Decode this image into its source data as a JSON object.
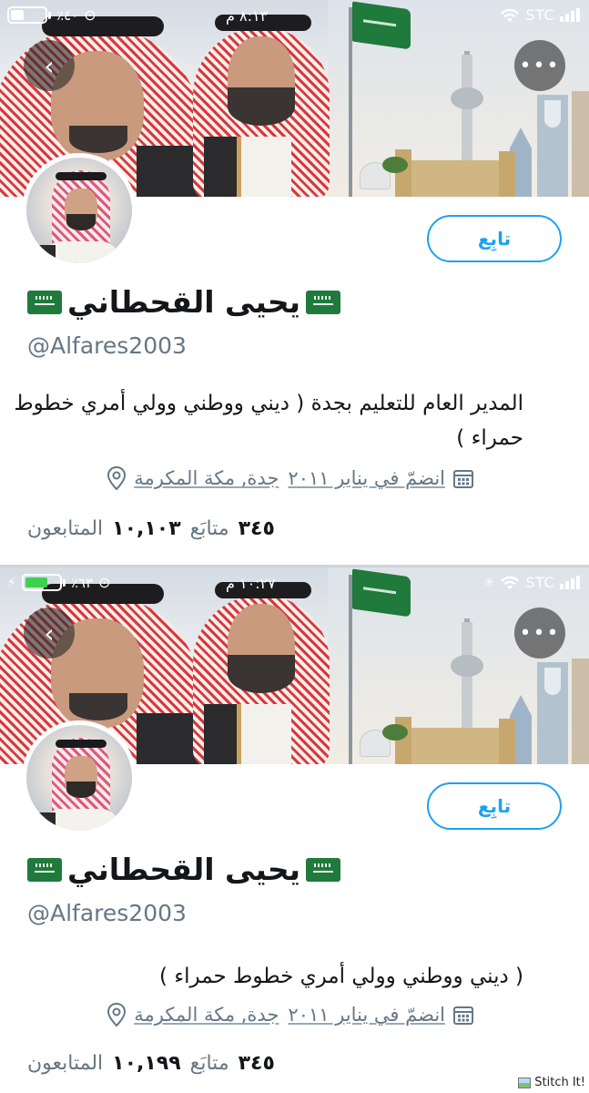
{
  "panels": [
    {
      "status": {
        "battery_percent": "٪٤٠",
        "time": "٨:١٣ م",
        "carrier": "STC"
      },
      "profile": {
        "name": "يحيى القحطاني",
        "handle": "@Alfares2003",
        "bio": "المدير العام للتعليم بجدة ( ديني ووطني وولي أمري خطوط حمراء )",
        "location": "جدة, مكة المكرمة",
        "joined": "انضمّ في يناير ٢٠١١",
        "following_count": "٣٤٥",
        "following_label": "متابَع",
        "followers_count": "١٠,١٠٣",
        "followers_label": "المتابعون",
        "follow_button": "تابِع"
      }
    },
    {
      "status": {
        "battery_percent": "٪٦٣",
        "time": "١٠:٢٧ م",
        "carrier": "STC"
      },
      "profile": {
        "name": "يحيى القحطاني",
        "handle": "@Alfares2003",
        "bio": "( ديني ووطني وولي أمري خطوط حمراء )",
        "location": "جدة, مكة المكرمة",
        "joined": "انضمّ في يناير ٢٠١١",
        "following_count": "٣٤٥",
        "following_label": "متابَع",
        "followers_count": "١٠,١٩٩",
        "followers_label": "المتابعون",
        "follow_button": "تابِع"
      }
    }
  ],
  "watermark": "Stitch It!",
  "icons": {
    "back": "chevron-left-icon",
    "more": "more-horizontal-icon",
    "location": "location-pin-icon",
    "calendar": "calendar-icon",
    "wifi": "wifi-icon",
    "flag": "saudi-flag-icon"
  },
  "colors": {
    "accent": "#1da1f2",
    "muted": "#657786",
    "text": "#14171a"
  }
}
